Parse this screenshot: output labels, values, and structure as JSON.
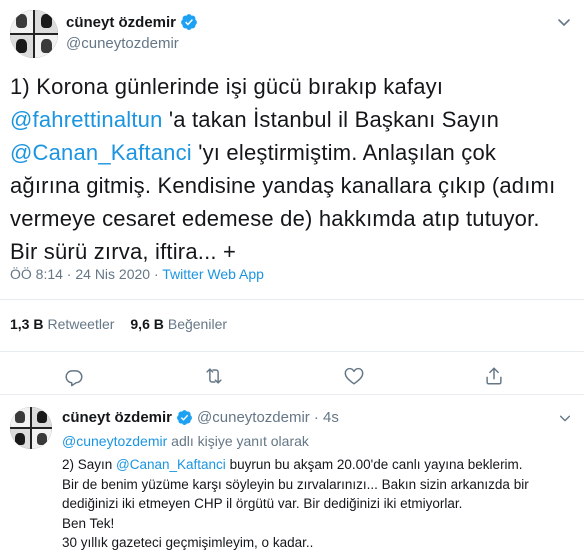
{
  "main_tweet": {
    "display_name": "cüneyt özdemir",
    "handle": "@cuneytozdemir",
    "text": {
      "part1": "1) Korona günlerinde işi gücü bırakıp kafayı ",
      "mention1": "@fahrettinaltun",
      "part2": " 'a takan İstanbul il Başkanı Sayın ",
      "mention2": "@Canan_Kaftanci",
      "part3": " 'yı eleştirmiştim. Anlaşılan çok ağırına gitmiş. Kendisine yandaş kanallara çıkıp (adımı vermeye cesaret edemese de) hakkımda atıp tutuyor. Bir sürü zırva, iftira... +"
    },
    "timestamp": "ÖÖ 8:14 · 24 Nis 2020",
    "separator": " · ",
    "source": "Twitter Web App",
    "stats": {
      "retweets_count": "1,3 B",
      "retweets_label": "Retweetler",
      "likes_count": "9,6 B",
      "likes_label": "Beğeniler"
    }
  },
  "reply_tweet": {
    "display_name": "cüneyt özdemir",
    "handle": "@cuneytozdemir",
    "time": "· 4s",
    "replying_to_mention": "@cuneytozdemir",
    "replying_to_suffix": " adlı kişiye yanıt olarak",
    "line1_prefix": "2) Sayın ",
    "line1_mention": "@Canan_Kaftanci",
    "line1_suffix": " buyrun bu akşam 20.00'de canlı yayına beklerim.",
    "line2": "Bir de benim yüzüme karşı söyleyin bu zırvalarınızı... Bakın sizin arkanızda bir",
    "line3": "dediğinizi iki etmeyen CHP il örgütü var. Bir dediğinizi iki etmiyorlar.",
    "line4": "Ben Tek!",
    "line5": "30 yıllık gazeteci geçmişimleyim, o kadar.."
  },
  "colors": {
    "link": "#1b95e0",
    "secondary_text": "#657786",
    "verified": "#1da1f2",
    "divider": "#e6ecf0"
  },
  "icons": [
    "verified-badge-icon",
    "chevron-down-icon",
    "reply-icon",
    "retweet-icon",
    "like-icon",
    "share-icon"
  ]
}
